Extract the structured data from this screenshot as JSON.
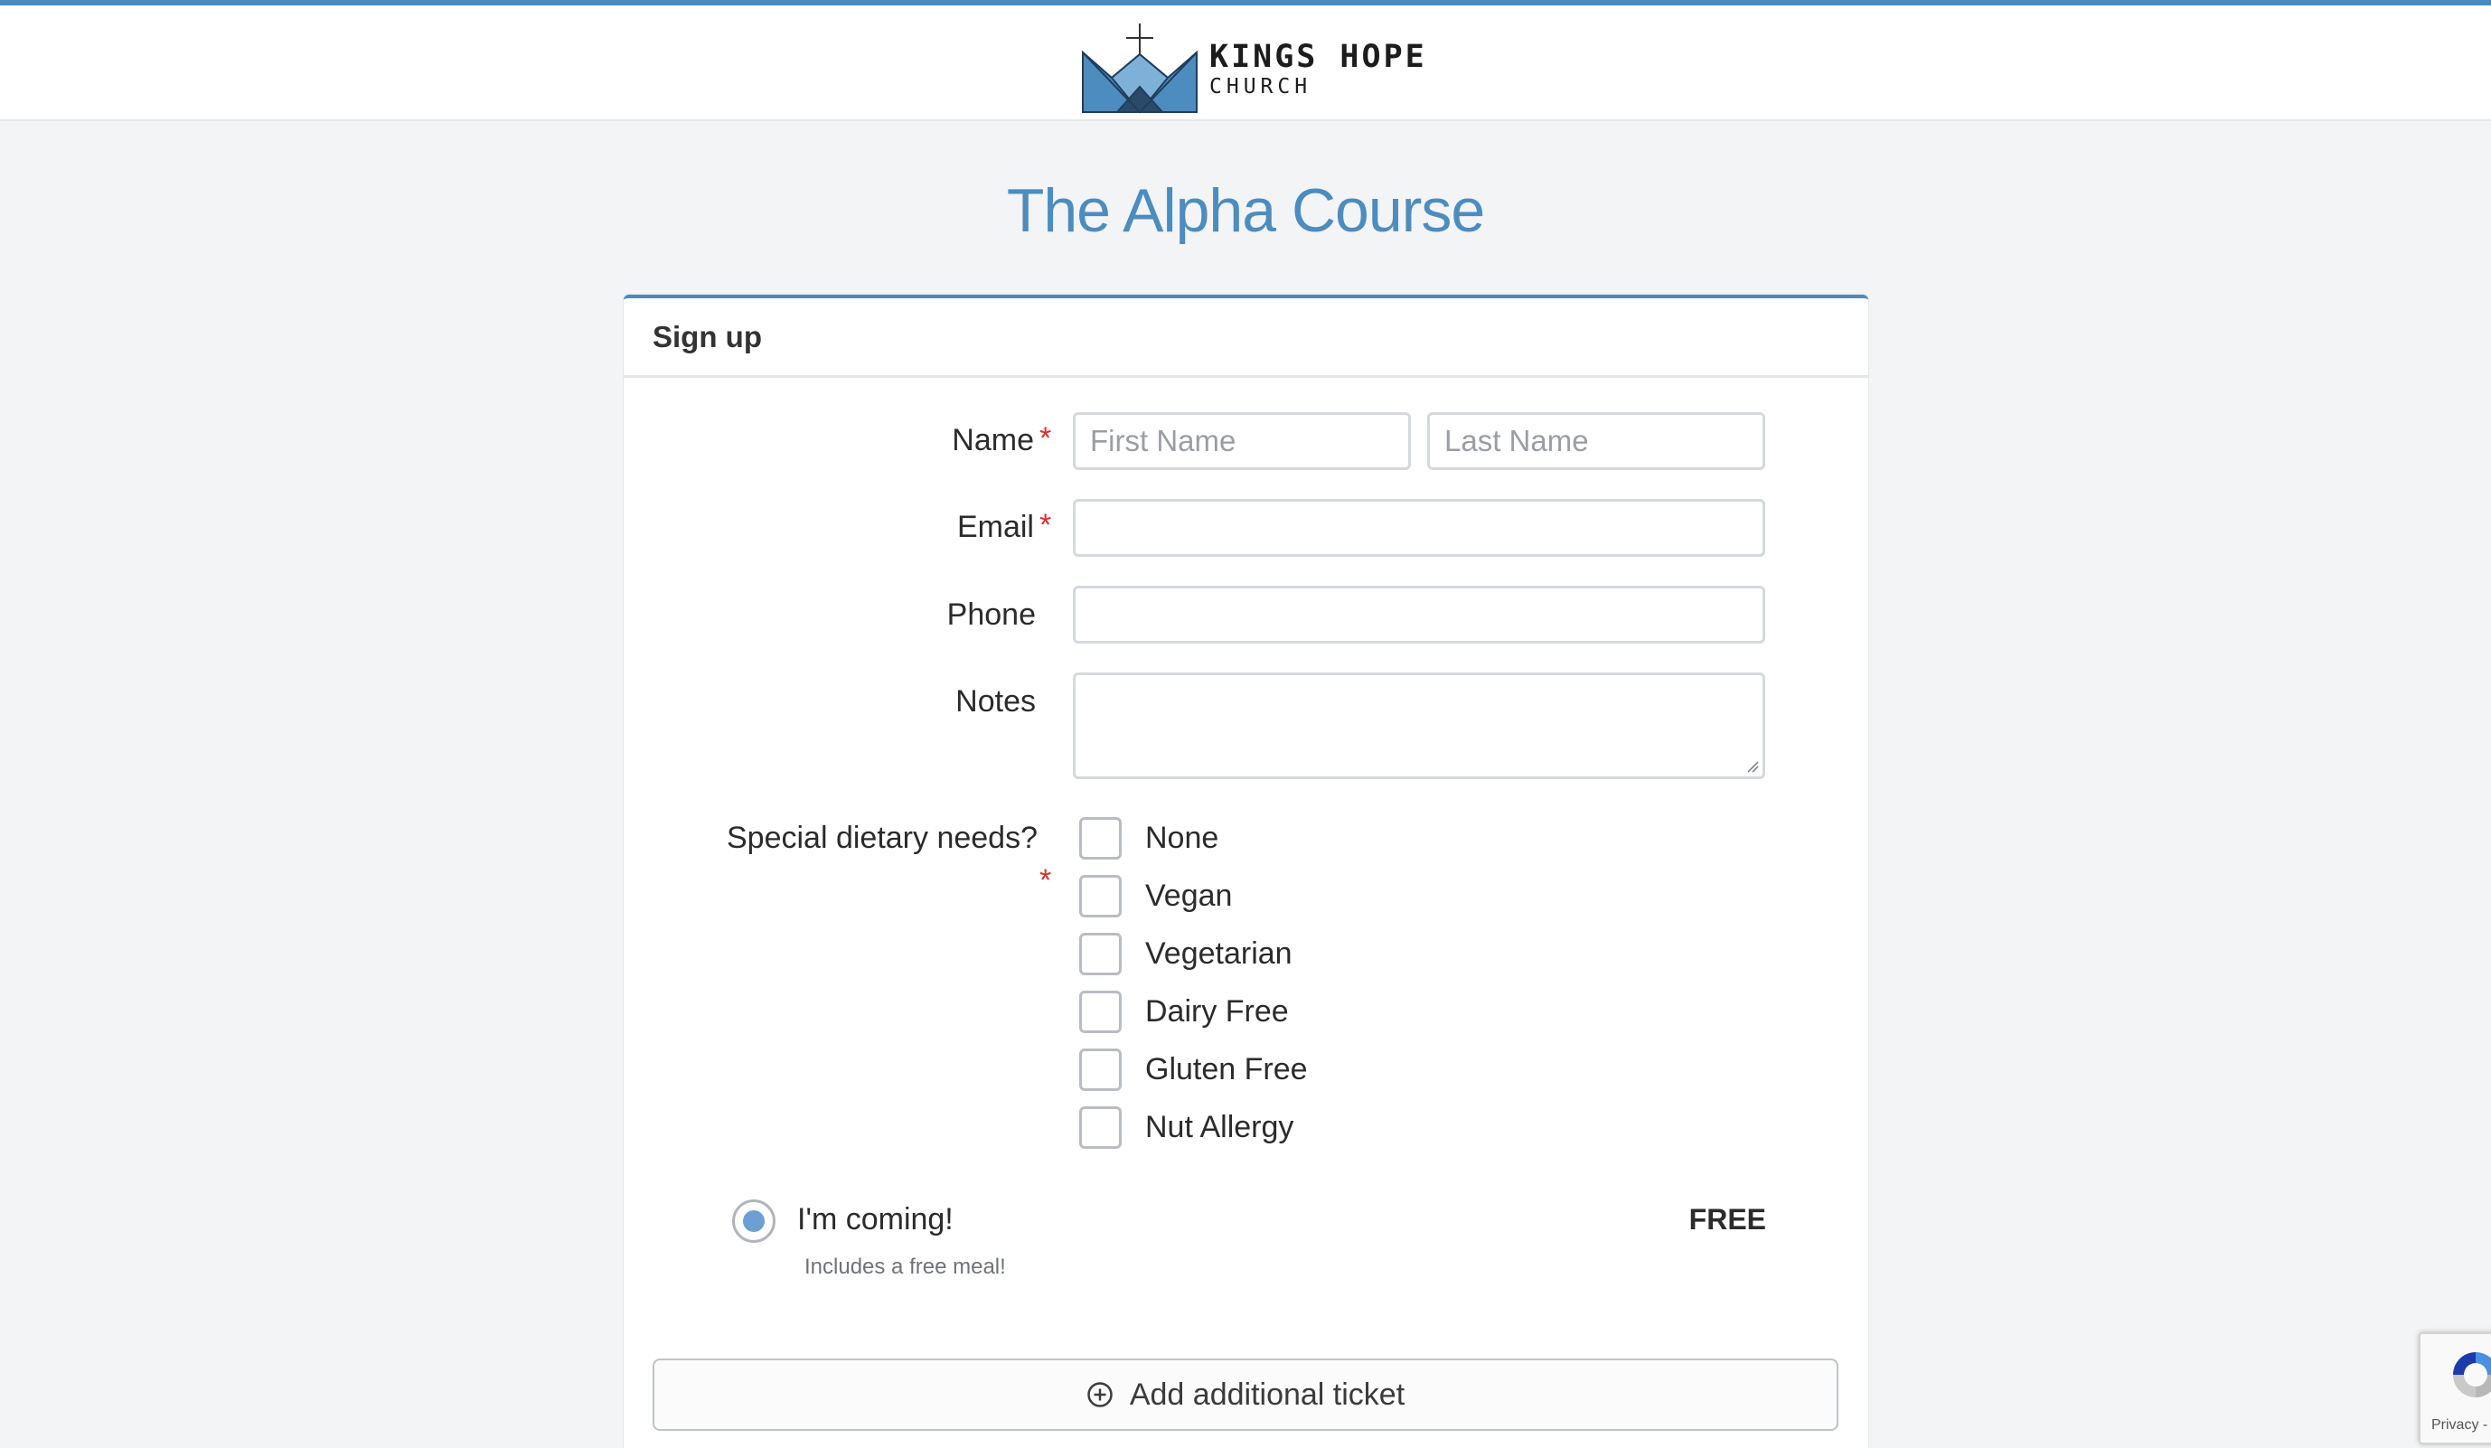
{
  "header": {
    "brand_line1": "KINGS HOPE",
    "brand_line2": "CHURCH"
  },
  "page": {
    "title": "The Alpha Course"
  },
  "form": {
    "card_title": "Sign up",
    "name_label": "Name",
    "first_name_placeholder": "First Name",
    "last_name_placeholder": "Last Name",
    "email_label": "Email",
    "phone_label": "Phone",
    "notes_label": "Notes",
    "required_mark": "*",
    "dietary_label": "Special dietary needs?",
    "dietary_options": [
      {
        "label": "None",
        "checked": false
      },
      {
        "label": "Vegan",
        "checked": false
      },
      {
        "label": "Vegetarian",
        "checked": false
      },
      {
        "label": "Dairy Free",
        "checked": false
      },
      {
        "label": "Gluten Free",
        "checked": false
      },
      {
        "label": "Nut Allergy",
        "checked": false
      }
    ]
  },
  "ticket": {
    "name": "I'm coming!",
    "price": "FREE",
    "note": "Includes a free meal!",
    "selected": true
  },
  "actions": {
    "add_ticket_label": "Add additional ticket"
  },
  "recaptcha": {
    "text": "Privacy - Terms"
  },
  "colors": {
    "accent": "#4a8ac0",
    "title": "#4d8cbf",
    "required": "#d6322b",
    "background": "#f3f4f5"
  }
}
